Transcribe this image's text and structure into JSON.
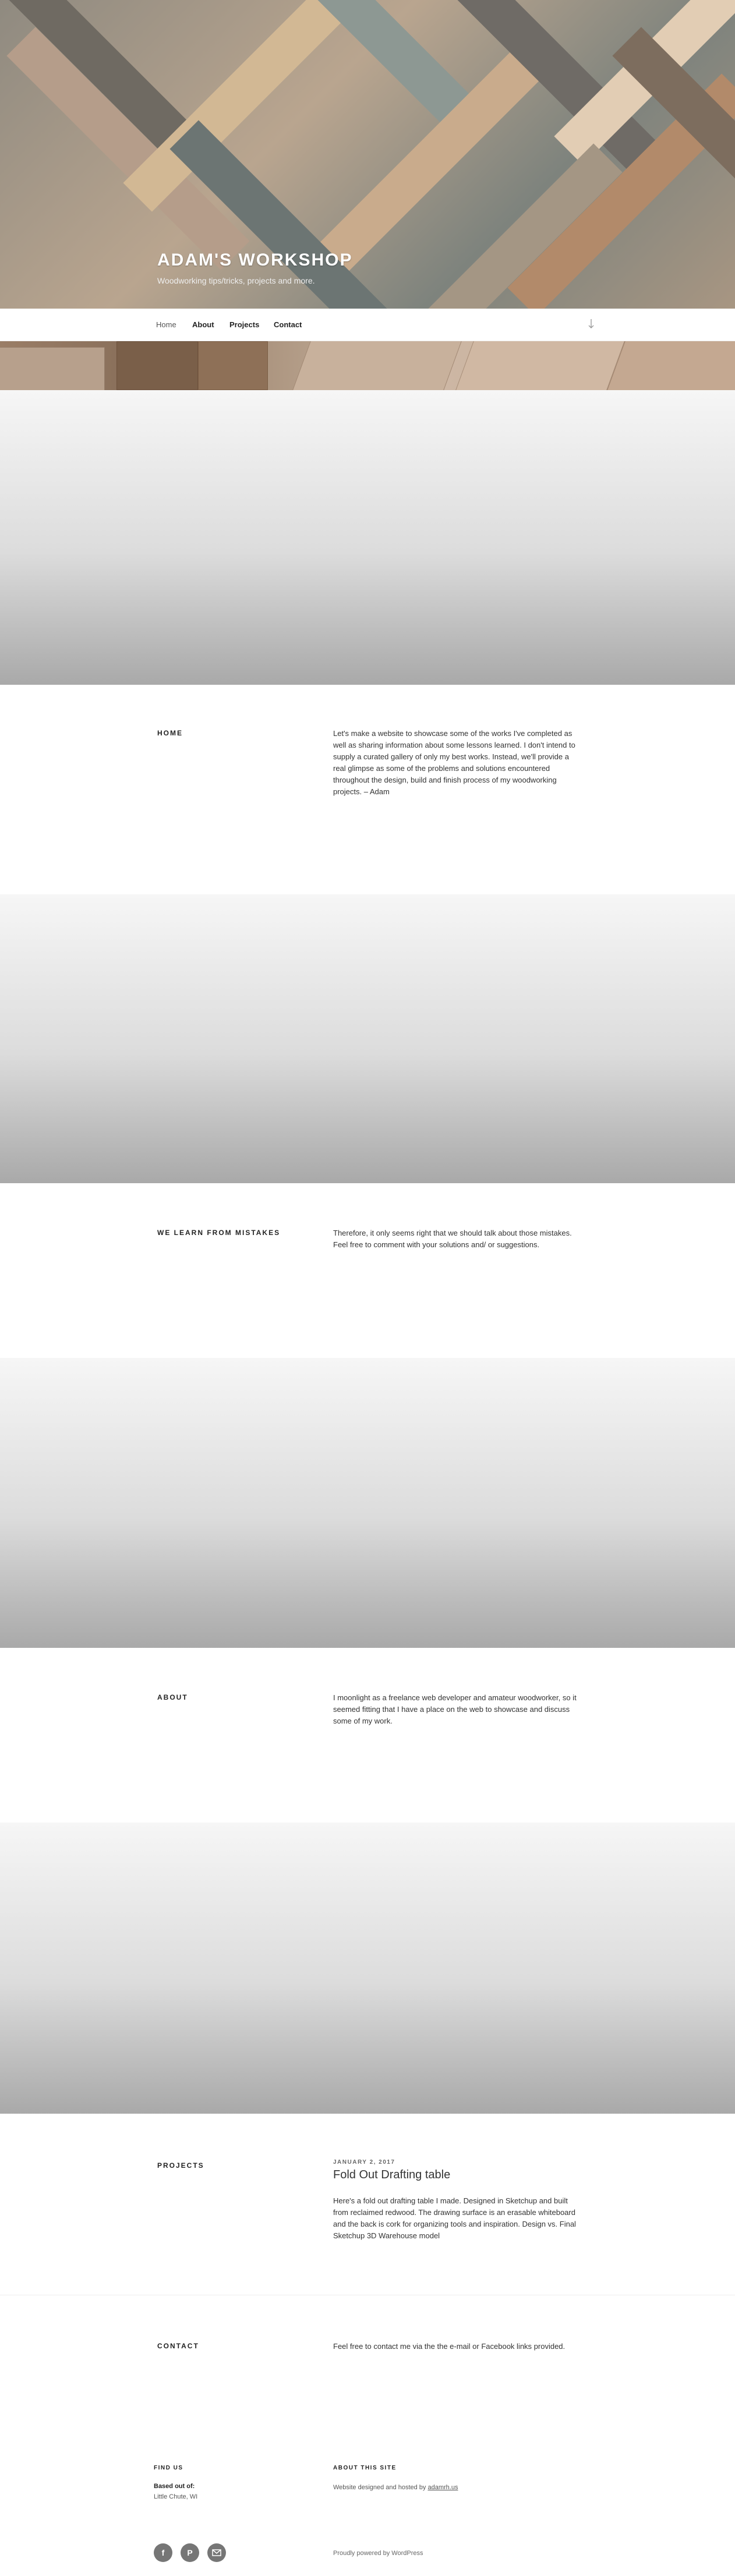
{
  "site": {
    "title": "ADAM'S WORKSHOP",
    "tagline": "Woodworking tips/tricks, projects and more."
  },
  "nav": {
    "items": [
      "Home",
      "About",
      "Projects",
      "Contact"
    ],
    "scroll_icon": "arrow-down-icon"
  },
  "sections": [
    {
      "title": "HOME",
      "body": "Let's make a website to showcase some of the works I've completed as well as sharing information about some lessons learned. I don't intend to supply a curated gallery of only my best works. Instead, we'll provide a real glimpse as some of the problems and solutions encountered throughout the design, build and finish process of my woodworking projects. – Adam"
    },
    {
      "title": "WE LEARN FROM MISTAKES",
      "body": "Therefore, it only seems right that we should talk about those mistakes. Feel free to comment with your solutions and/ or suggestions."
    },
    {
      "title": "ABOUT",
      "body": "I moonlight as a freelance web developer and amateur woodworker, so it seemed fitting that I have a place on the web to showcase and discuss some of my work."
    },
    {
      "title": "PROJECTS",
      "date": "JANUARY 2, 2017",
      "post_title": "Fold Out Drafting table",
      "body": "Here's a fold out drafting table I made. Designed in Sketchup and built from reclaimed redwood. The drawing surface is an erasable whiteboard and the back is cork for organizing tools and inspiration. Design vs. Final Sketchup 3D Warehouse model"
    },
    {
      "title": "CONTACT",
      "body": "Feel free to contact me via the the e-mail or Facebook links provided."
    }
  ],
  "footer": {
    "find_us_heading": "FIND US",
    "based_out_label": "Based out of:",
    "location": "Little Chute, WI",
    "about_heading": "ABOUT THIS SITE",
    "about_text_prefix": "Website designed and hosted by ",
    "about_link": "adamrh.us",
    "powered_by": "Proudly powered by WordPress",
    "social_icons": [
      "facebook-icon",
      "pinterest-icon",
      "email-icon"
    ]
  },
  "colors": {
    "social_bg": "#767676",
    "panel_top": "#f6f6f6",
    "panel_bottom": "#a9a9a9"
  }
}
